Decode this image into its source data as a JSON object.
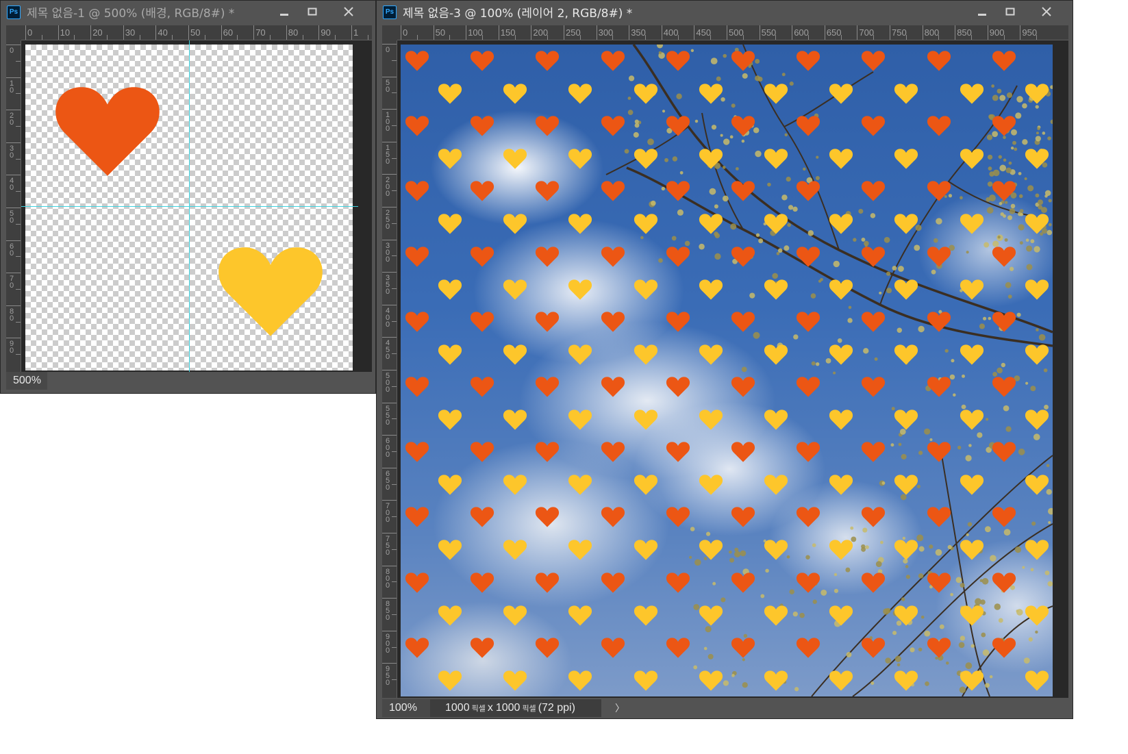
{
  "colors": {
    "heart_orange": "#ec5614",
    "heart_yellow": "#fdc62b",
    "guide": "#3fd3e0",
    "panel": "#535353",
    "ruler": "#3f3f3f"
  },
  "window1": {
    "app_icon": "Ps",
    "title": "제목 없음-1 @ 500% (배경, RGB/8#) *",
    "zoom": "500%",
    "ruler_h": [
      "0",
      "10",
      "20",
      "30",
      "40",
      "50",
      "60",
      "70",
      "80",
      "90",
      "1"
    ],
    "ruler_v": [
      "0",
      "10",
      "20",
      "30",
      "40",
      "50",
      "60",
      "70",
      "80",
      "90"
    ]
  },
  "window2": {
    "app_icon": "Ps",
    "title": "제목 없음-3 @ 100% (레이어 2, RGB/8#) *",
    "zoom": "100%",
    "doc_info": {
      "width": "1000",
      "unit": "픽셀",
      "times": "x",
      "height": "1000",
      "resolution": "(72 ppi)"
    },
    "status_arrow": "〉",
    "ruler_h": [
      "0",
      "50",
      "100",
      "150",
      "200",
      "250",
      "300",
      "350",
      "400",
      "450",
      "500",
      "550",
      "600",
      "650",
      "700",
      "750",
      "800",
      "850",
      "900",
      "950"
    ],
    "ruler_v": [
      "0",
      "50",
      "100",
      "150",
      "200",
      "250",
      "300",
      "350",
      "400",
      "450",
      "500",
      "550",
      "600",
      "650",
      "700",
      "750",
      "800",
      "850",
      "900",
      "950"
    ]
  },
  "window_controls": {
    "minimize_icon": "minimize-icon",
    "maximize_icon": "maximize-icon",
    "close_icon": "close-icon"
  }
}
